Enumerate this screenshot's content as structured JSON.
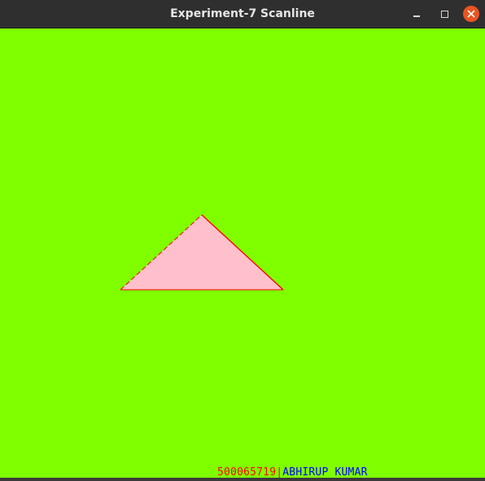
{
  "window": {
    "title": "Experiment-7 Scanline"
  },
  "controls": {
    "minimize_icon": "minimize-icon",
    "maximize_icon": "maximize-icon",
    "close_icon": "close-icon",
    "close_glyph": "✕"
  },
  "canvas": {
    "background_color": "#7fff00",
    "triangle": {
      "fill_color": "#ffc0cb",
      "edge_color": "#ff0000"
    },
    "footer": {
      "id_text": "500065719",
      "separator": "|",
      "name_text": "ABHIRUP KUMAR",
      "id_color": "#ff0000",
      "name_color": "#0000ff"
    }
  }
}
